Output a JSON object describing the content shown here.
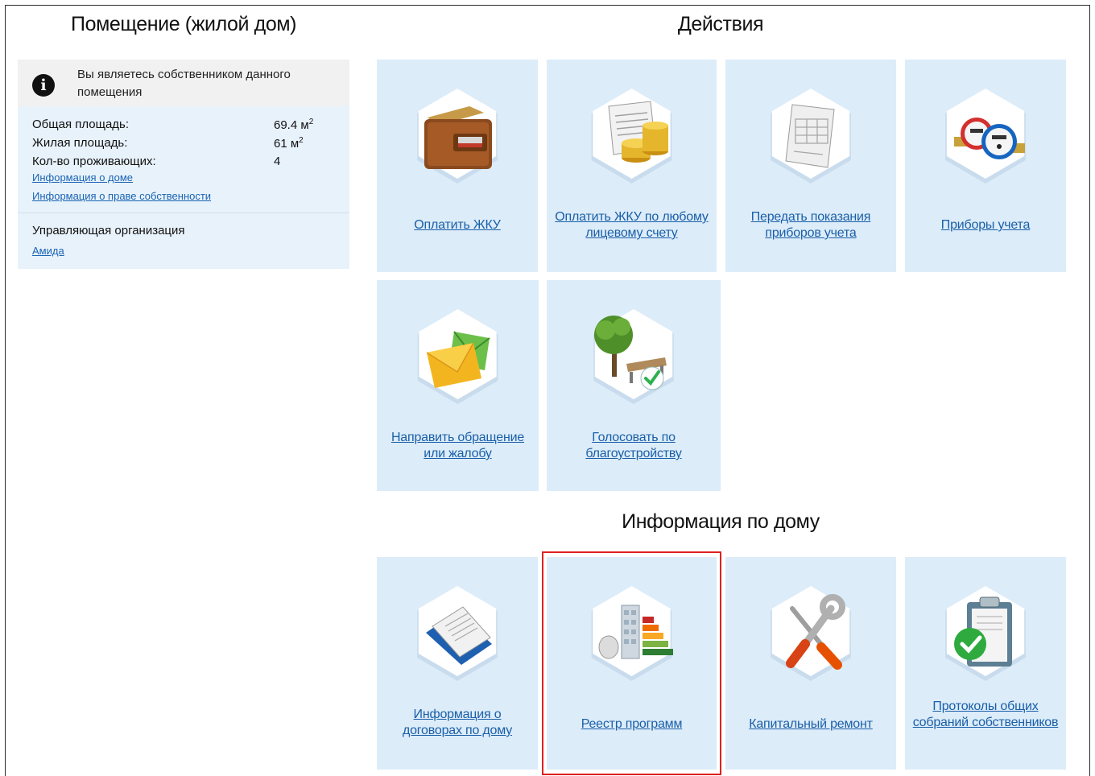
{
  "premises": {
    "title": "Помещение (жилой дом)",
    "notice": "Вы являетесь собственником данного помещения",
    "properties": [
      {
        "label": "Общая площадь:",
        "value": "69.4 м",
        "sup": "2"
      },
      {
        "label": "Жилая площадь:",
        "value": "61 м",
        "sup": "2"
      },
      {
        "label": "Кол-во проживающих:",
        "value": "4",
        "sup": ""
      }
    ],
    "links": {
      "house_info": "Информация о доме",
      "ownership_info": "Информация о праве собственности"
    },
    "org_label": "Управляющая организация",
    "org_link": "Амида"
  },
  "actions": {
    "title": "Действия",
    "tiles": [
      {
        "label": "Оплатить ЖКУ",
        "icon": "wallet-icon"
      },
      {
        "label": "Оплатить ЖКУ по любому лицевому счету",
        "icon": "bill-coins-icon"
      },
      {
        "label": "Передать показания приборов учета",
        "icon": "meter-readings-form-icon"
      },
      {
        "label": "Приборы учета",
        "icon": "water-meter-icon"
      },
      {
        "label": "Направить обращение или жалобу",
        "icon": "envelopes-icon"
      },
      {
        "label": "Голосовать по благоустройству",
        "icon": "tree-bench-vote-icon"
      }
    ]
  },
  "house_info": {
    "title": "Информация по дому",
    "tiles": [
      {
        "label": "Информация о договорах по дому",
        "icon": "contract-document-icon"
      },
      {
        "label": "Реестр программ",
        "icon": "building-energy-rating-icon"
      },
      {
        "label": "Капитальный ремонт",
        "icon": "wrench-screwdriver-icon"
      },
      {
        "label": "Протоколы общих собраний собственников",
        "icon": "clipboard-check-icon"
      }
    ]
  },
  "colors": {
    "tile_bg": "#dcecf9",
    "link": "#1a5fa8",
    "highlight": "#e02020"
  }
}
